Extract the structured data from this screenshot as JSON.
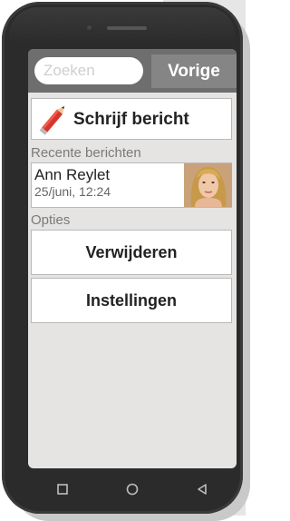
{
  "search": {
    "placeholder": "Zoeken",
    "value": ""
  },
  "header": {
    "back_label": "Vorige"
  },
  "compose": {
    "label": "Schrijf bericht",
    "icon": "pencil-icon"
  },
  "recent": {
    "section_label": "Recente berichten",
    "messages": [
      {
        "name": "Ann Reylet",
        "time": "25/juni, 12:24",
        "avatar": "contact-photo"
      }
    ]
  },
  "options": {
    "section_label": "Opties",
    "buttons": [
      "Verwijderen",
      "Instellingen"
    ]
  },
  "navbar": {
    "icons": [
      "recent-apps-icon",
      "home-icon",
      "back-icon"
    ]
  },
  "colors": {
    "topbar": "#6e6e6e",
    "back_button": "#858585",
    "screen_bg": "#e5e4e2",
    "pencil": "#d9342b"
  }
}
